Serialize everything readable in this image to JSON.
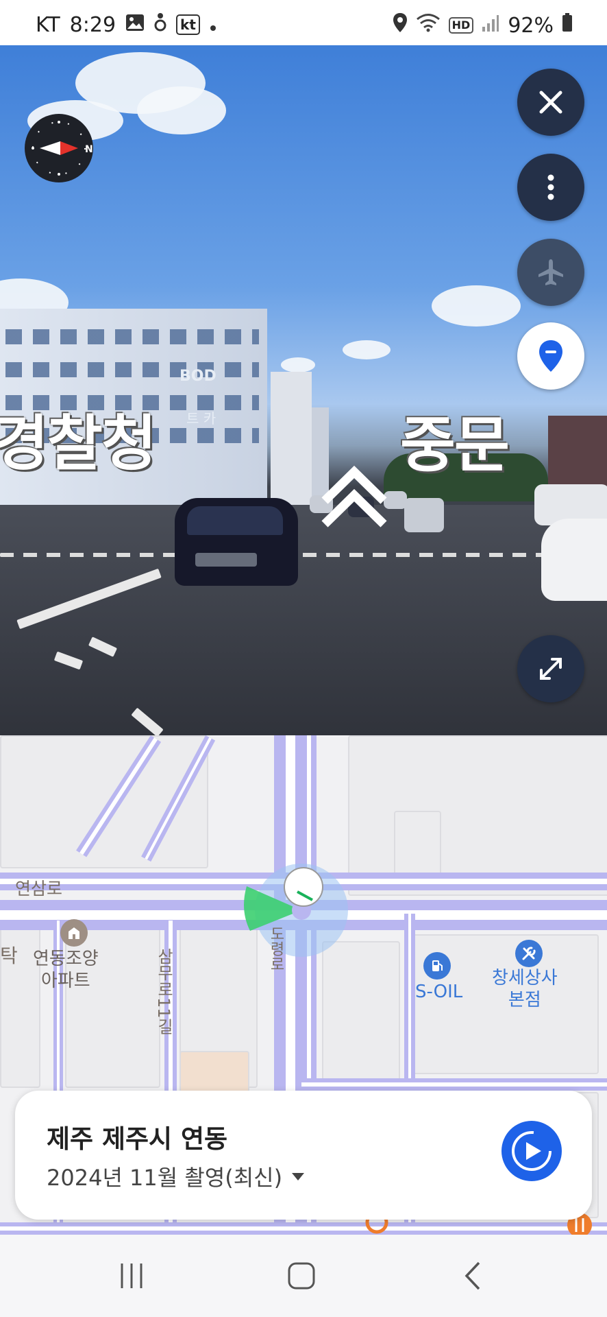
{
  "status_bar": {
    "carrier": "KT",
    "time": "8:29",
    "kt_badge": "kt",
    "hd_badge": "HD",
    "battery": "92%"
  },
  "street_view": {
    "overlay_left": "경찰청",
    "overlay_right": "중문",
    "building_sign_1": "BOD",
    "building_sign_2": "트 카"
  },
  "map": {
    "road_label_1": "연삼로",
    "road_label_2": "삼무로11길",
    "road_label_3": "도령로",
    "edge_label": "탁",
    "poi_apartment": "연동조양\n아파트",
    "poi_gas": "S-OIL",
    "poi_shop": "창세상사\n본점"
  },
  "card": {
    "title": "제주 제주시 연동",
    "subtitle": "2024년 11월 촬영(최신)"
  },
  "colors": {
    "fab_dark": "#243048",
    "accent_blue": "#1e62e8",
    "road_purple": "#b9b6f0",
    "view_cone_green": "#3ccf70"
  },
  "icons": {
    "close": "close-icon",
    "more": "more-vertical-icon",
    "airplane": "airplane-icon",
    "location": "location-pin-icon",
    "expand": "expand-icon",
    "compass": "compass-icon",
    "play": "play-icon"
  }
}
